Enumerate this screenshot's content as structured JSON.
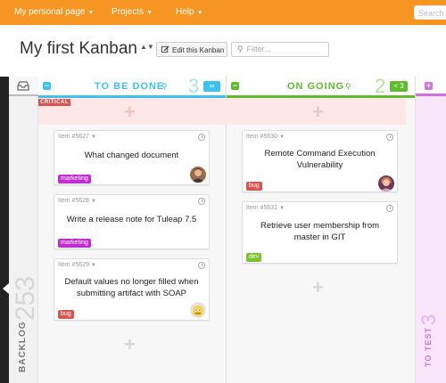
{
  "nav": {
    "items": [
      {
        "label": "My personal page"
      },
      {
        "label": "Projects"
      },
      {
        "label": "Help"
      }
    ],
    "search_placeholder": "Search"
  },
  "header": {
    "title": "My first Kanban",
    "title_caret": "▲▼",
    "edit_button_label": "Edit this Kanban",
    "filter_placeholder": "Filter..."
  },
  "backlog": {
    "count": "253",
    "label": "BACKLOG"
  },
  "swimlane": {
    "critical_label": "CRITICAL"
  },
  "columns": [
    {
      "label": "TO BE DONE",
      "count": "3",
      "badge": "∞",
      "color": "#3ec1ef",
      "cards": [
        {
          "id": "Item #5627",
          "title": "What changed document",
          "tag": "marketing",
          "tag_color": "#c22bd6",
          "avatar": "man-avatar"
        },
        {
          "id": "Item #5628",
          "title": "Write a release note for Tuleap 7.5",
          "tag": "marketing",
          "tag_color": "#c22bd6",
          "avatar": ""
        },
        {
          "id": "Item #5629",
          "title": "Default values no longer filled when submitting artifact with SOAP",
          "tag": "bug",
          "tag_color": "#d9534f",
          "avatar": "yellow-avatar"
        }
      ]
    },
    {
      "label": "ON GOING",
      "count": "2",
      "badge": "< 3",
      "color": "#5fbc2d",
      "cards": [
        {
          "id": "Item #5630",
          "title": "Remote Command Execution Vulnerability",
          "tag": "bug",
          "tag_color": "#d9534f",
          "avatar": "woman-avatar"
        },
        {
          "id": "Item #5631",
          "title": "Retrieve user membership from master in GIT",
          "tag": "dev",
          "tag_color": "#7cc22b",
          "avatar": ""
        }
      ]
    }
  ],
  "to_test": {
    "count": "3",
    "label": "TO TEST",
    "color": "#d070e0"
  },
  "colors": {
    "navbar": "#f79523",
    "critical": "#d9534f",
    "critical_band": "#fde7e7"
  }
}
